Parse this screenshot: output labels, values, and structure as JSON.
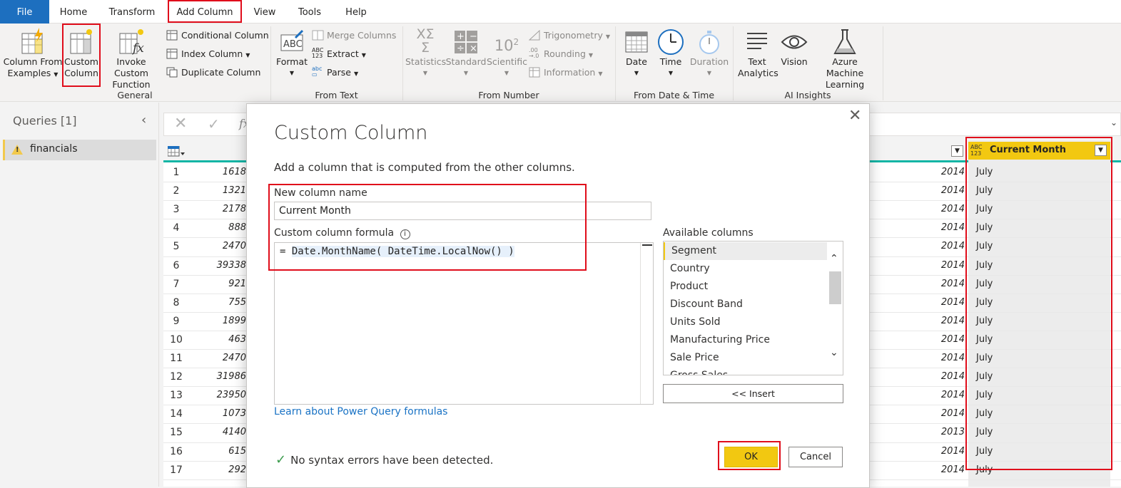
{
  "tabs": [
    "File",
    "Home",
    "Transform",
    "Add Column",
    "View",
    "Tools",
    "Help"
  ],
  "ribbon": {
    "general": {
      "label": "General",
      "column_from_examples": [
        "Column From",
        "Examples"
      ],
      "custom_column": [
        "Custom",
        "Column"
      ],
      "invoke_custom_function": [
        "Invoke Custom",
        "Function"
      ],
      "conditional_column": "Conditional Column",
      "index_column": "Index Column",
      "duplicate_column": "Duplicate Column"
    },
    "from_text": {
      "label": "From Text",
      "format": "Format",
      "merge_columns": "Merge Columns",
      "extract": "Extract",
      "parse": "Parse"
    },
    "from_number": {
      "label": "From Number",
      "statistics": "Statistics",
      "standard": "Standard",
      "scientific": "Scientific",
      "trigonometry": "Trigonometry",
      "rounding": "Rounding",
      "information": "Information"
    },
    "from_date_time": {
      "label": "From Date & Time",
      "date": "Date",
      "time": "Time",
      "duration": "Duration"
    },
    "ai_insights": {
      "label": "AI Insights",
      "text_analytics": [
        "Text",
        "Analytics"
      ],
      "vision": "Vision",
      "azure_ml": [
        "Azure Machine",
        "Learning"
      ]
    }
  },
  "queries": {
    "title": "Queries [1]",
    "items": [
      "financials"
    ]
  },
  "grid": {
    "current_month_header": "Current Month",
    "type_badge_top": "ABC",
    "type_badge_bottom": "123",
    "rows": [
      {
        "n": "1",
        "num": "1618",
        "year": "2014",
        "month": "July"
      },
      {
        "n": "2",
        "num": "1321",
        "year": "2014",
        "month": "July"
      },
      {
        "n": "3",
        "num": "2178",
        "year": "2014",
        "month": "July"
      },
      {
        "n": "4",
        "num": "888",
        "year": "2014",
        "month": "July"
      },
      {
        "n": "5",
        "num": "2470",
        "year": "2014",
        "month": "July"
      },
      {
        "n": "6",
        "num": "39338",
        "year": "2014",
        "month": "July"
      },
      {
        "n": "7",
        "num": "921",
        "year": "2014",
        "month": "July"
      },
      {
        "n": "8",
        "num": "755",
        "year": "2014",
        "month": "July"
      },
      {
        "n": "9",
        "num": "1899",
        "year": "2014",
        "month": "July"
      },
      {
        "n": "10",
        "num": "463",
        "year": "2014",
        "month": "July"
      },
      {
        "n": "11",
        "num": "2470",
        "year": "2014",
        "month": "July"
      },
      {
        "n": "12",
        "num": "31986",
        "year": "2014",
        "month": "July"
      },
      {
        "n": "13",
        "num": "23950",
        "year": "2014",
        "month": "July"
      },
      {
        "n": "14",
        "num": "1073",
        "year": "2014",
        "month": "July"
      },
      {
        "n": "15",
        "num": "4140",
        "year": "2013",
        "month": "July"
      },
      {
        "n": "16",
        "num": "615",
        "year": "2014",
        "month": "July"
      },
      {
        "n": "17",
        "num": "292",
        "year": "2014",
        "month": "July"
      }
    ]
  },
  "dialog": {
    "title": "Custom Column",
    "subtitle": "Add a column that is computed from the other columns.",
    "new_column_label": "New column name",
    "new_column_value": "Current Month",
    "formula_label": "Custom column formula",
    "formula_prefix": "= ",
    "formula_value": "Date.MonthName( DateTime.LocalNow() )",
    "available_label": "Available columns",
    "available_columns": [
      "Segment",
      "Country",
      "Product",
      "Discount Band",
      "Units Sold",
      "Manufacturing Price",
      "Sale Price",
      "Gross Sales"
    ],
    "insert_button": "<< Insert",
    "learn_link": "Learn about Power Query formulas",
    "status": "No syntax errors have been detected.",
    "ok": "OK",
    "cancel": "Cancel"
  }
}
